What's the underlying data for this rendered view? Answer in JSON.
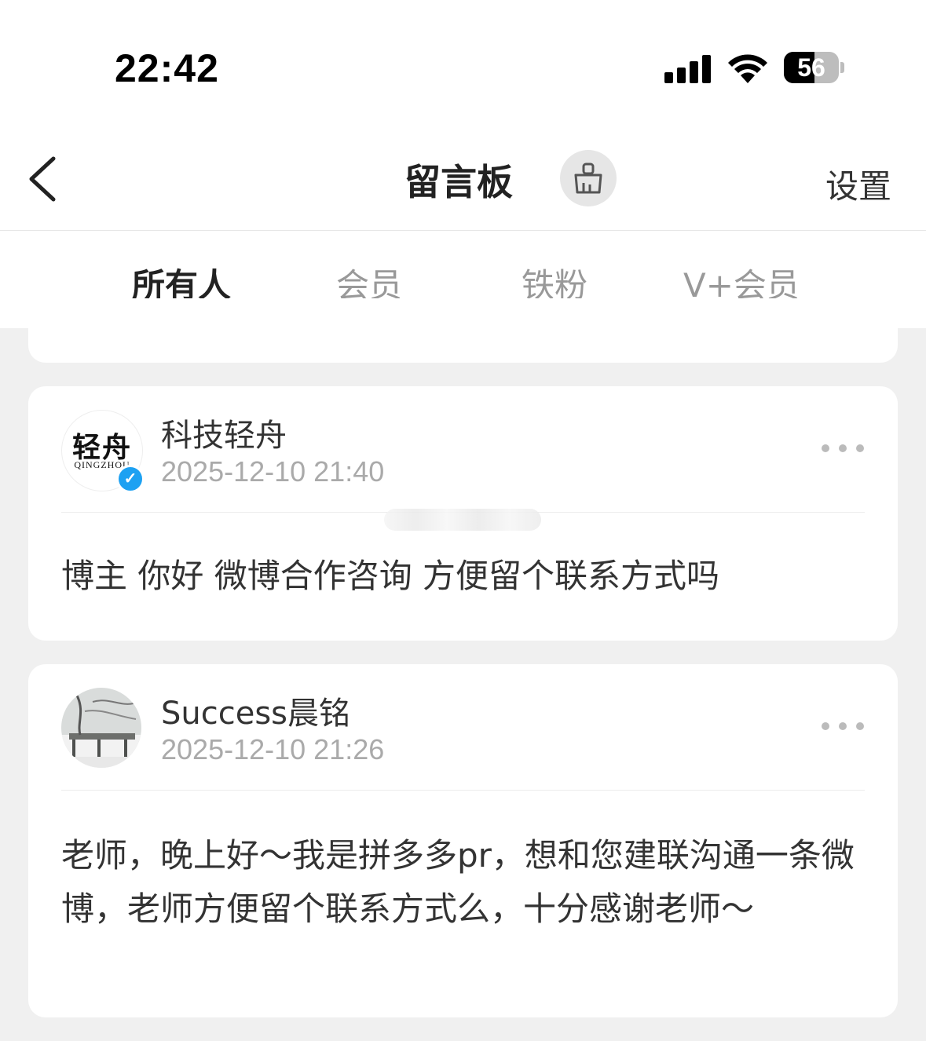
{
  "status_bar": {
    "time": "22:42",
    "battery": "56",
    "battery_level": 0.56
  },
  "header": {
    "title": "留言板",
    "settings_label": "设置"
  },
  "tabs": [
    {
      "label": "所有人",
      "active": true
    },
    {
      "label": "会员",
      "active": false
    },
    {
      "label": "铁粉",
      "active": false
    },
    {
      "label": "V+会员",
      "active": false
    }
  ],
  "messages": [
    {
      "username": "科技轻舟",
      "timestamp": "2025-12-10 21:40",
      "verified": true,
      "avatar_text": "轻舟",
      "avatar_subtext": "QINGZHOU",
      "content": "博主 你好 微博合作咨询 方便留个联系方式吗"
    },
    {
      "username": "Success晨铭",
      "timestamp": "2025-12-10 21:26",
      "verified": false,
      "content": "老师，晚上好～我是拼多多pr，想和您建联沟通一条微博，老师方便留个联系方式么，十分感谢老师～"
    }
  ],
  "colors": {
    "accent": "#ff8200",
    "verified": "#1da1f2",
    "background": "#f0f0f0"
  },
  "icons": [
    "back-icon",
    "broom-icon",
    "more-icon",
    "verified-icon",
    "signal-icon",
    "wifi-icon",
    "battery-icon"
  ]
}
